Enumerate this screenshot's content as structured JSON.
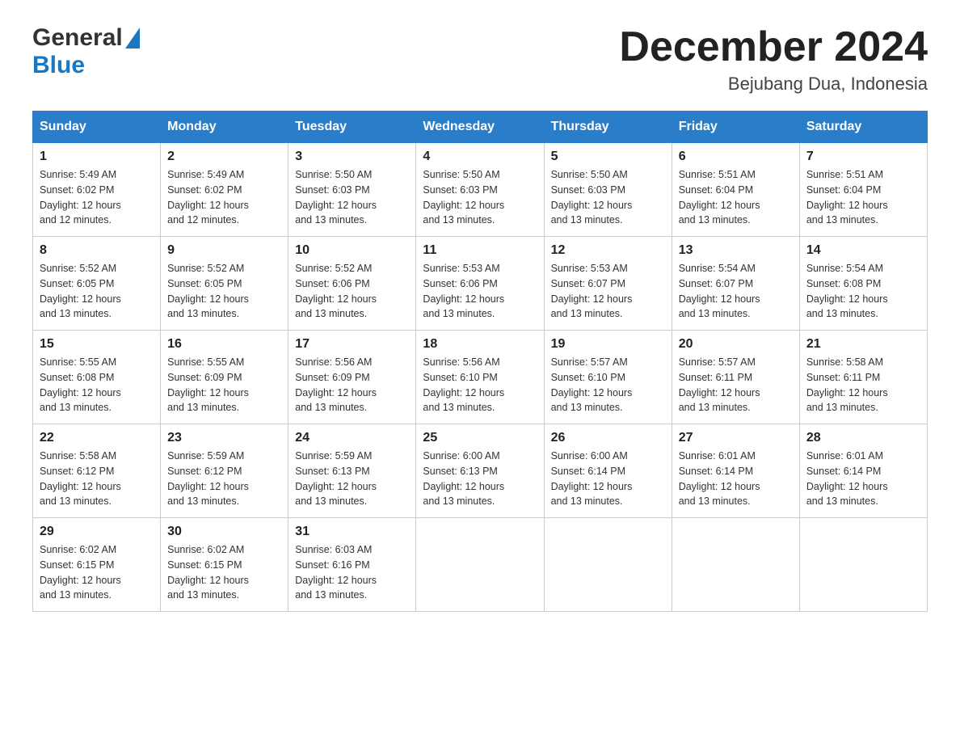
{
  "logo": {
    "general": "General",
    "blue": "Blue"
  },
  "title": "December 2024",
  "location": "Bejubang Dua, Indonesia",
  "weekdays": [
    "Sunday",
    "Monday",
    "Tuesday",
    "Wednesday",
    "Thursday",
    "Friday",
    "Saturday"
  ],
  "weeks": [
    [
      {
        "day": "1",
        "sunrise": "5:49 AM",
        "sunset": "6:02 PM",
        "daylight": "12 hours and 12 minutes."
      },
      {
        "day": "2",
        "sunrise": "5:49 AM",
        "sunset": "6:02 PM",
        "daylight": "12 hours and 12 minutes."
      },
      {
        "day": "3",
        "sunrise": "5:50 AM",
        "sunset": "6:03 PM",
        "daylight": "12 hours and 13 minutes."
      },
      {
        "day": "4",
        "sunrise": "5:50 AM",
        "sunset": "6:03 PM",
        "daylight": "12 hours and 13 minutes."
      },
      {
        "day": "5",
        "sunrise": "5:50 AM",
        "sunset": "6:03 PM",
        "daylight": "12 hours and 13 minutes."
      },
      {
        "day": "6",
        "sunrise": "5:51 AM",
        "sunset": "6:04 PM",
        "daylight": "12 hours and 13 minutes."
      },
      {
        "day": "7",
        "sunrise": "5:51 AM",
        "sunset": "6:04 PM",
        "daylight": "12 hours and 13 minutes."
      }
    ],
    [
      {
        "day": "8",
        "sunrise": "5:52 AM",
        "sunset": "6:05 PM",
        "daylight": "12 hours and 13 minutes."
      },
      {
        "day": "9",
        "sunrise": "5:52 AM",
        "sunset": "6:05 PM",
        "daylight": "12 hours and 13 minutes."
      },
      {
        "day": "10",
        "sunrise": "5:52 AM",
        "sunset": "6:06 PM",
        "daylight": "12 hours and 13 minutes."
      },
      {
        "day": "11",
        "sunrise": "5:53 AM",
        "sunset": "6:06 PM",
        "daylight": "12 hours and 13 minutes."
      },
      {
        "day": "12",
        "sunrise": "5:53 AM",
        "sunset": "6:07 PM",
        "daylight": "12 hours and 13 minutes."
      },
      {
        "day": "13",
        "sunrise": "5:54 AM",
        "sunset": "6:07 PM",
        "daylight": "12 hours and 13 minutes."
      },
      {
        "day": "14",
        "sunrise": "5:54 AM",
        "sunset": "6:08 PM",
        "daylight": "12 hours and 13 minutes."
      }
    ],
    [
      {
        "day": "15",
        "sunrise": "5:55 AM",
        "sunset": "6:08 PM",
        "daylight": "12 hours and 13 minutes."
      },
      {
        "day": "16",
        "sunrise": "5:55 AM",
        "sunset": "6:09 PM",
        "daylight": "12 hours and 13 minutes."
      },
      {
        "day": "17",
        "sunrise": "5:56 AM",
        "sunset": "6:09 PM",
        "daylight": "12 hours and 13 minutes."
      },
      {
        "day": "18",
        "sunrise": "5:56 AM",
        "sunset": "6:10 PM",
        "daylight": "12 hours and 13 minutes."
      },
      {
        "day": "19",
        "sunrise": "5:57 AM",
        "sunset": "6:10 PM",
        "daylight": "12 hours and 13 minutes."
      },
      {
        "day": "20",
        "sunrise": "5:57 AM",
        "sunset": "6:11 PM",
        "daylight": "12 hours and 13 minutes."
      },
      {
        "day": "21",
        "sunrise": "5:58 AM",
        "sunset": "6:11 PM",
        "daylight": "12 hours and 13 minutes."
      }
    ],
    [
      {
        "day": "22",
        "sunrise": "5:58 AM",
        "sunset": "6:12 PM",
        "daylight": "12 hours and 13 minutes."
      },
      {
        "day": "23",
        "sunrise": "5:59 AM",
        "sunset": "6:12 PM",
        "daylight": "12 hours and 13 minutes."
      },
      {
        "day": "24",
        "sunrise": "5:59 AM",
        "sunset": "6:13 PM",
        "daylight": "12 hours and 13 minutes."
      },
      {
        "day": "25",
        "sunrise": "6:00 AM",
        "sunset": "6:13 PM",
        "daylight": "12 hours and 13 minutes."
      },
      {
        "day": "26",
        "sunrise": "6:00 AM",
        "sunset": "6:14 PM",
        "daylight": "12 hours and 13 minutes."
      },
      {
        "day": "27",
        "sunrise": "6:01 AM",
        "sunset": "6:14 PM",
        "daylight": "12 hours and 13 minutes."
      },
      {
        "day": "28",
        "sunrise": "6:01 AM",
        "sunset": "6:14 PM",
        "daylight": "12 hours and 13 minutes."
      }
    ],
    [
      {
        "day": "29",
        "sunrise": "6:02 AM",
        "sunset": "6:15 PM",
        "daylight": "12 hours and 13 minutes."
      },
      {
        "day": "30",
        "sunrise": "6:02 AM",
        "sunset": "6:15 PM",
        "daylight": "12 hours and 13 minutes."
      },
      {
        "day": "31",
        "sunrise": "6:03 AM",
        "sunset": "6:16 PM",
        "daylight": "12 hours and 13 minutes."
      },
      null,
      null,
      null,
      null
    ]
  ],
  "labels": {
    "sunrise": "Sunrise:",
    "sunset": "Sunset:",
    "daylight": "Daylight:"
  }
}
